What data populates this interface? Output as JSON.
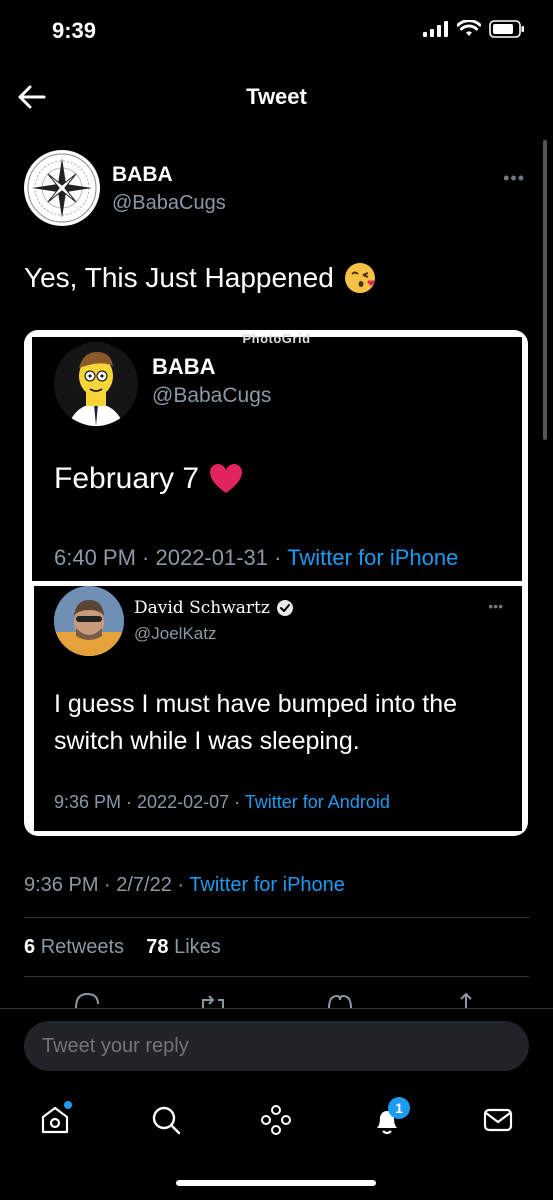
{
  "status_bar": {
    "time": "9:39"
  },
  "header": {
    "title": "Tweet"
  },
  "tweet": {
    "author_name": "BABA",
    "author_handle": "@BabaCugs",
    "more": "•••",
    "text": "Yes, This Just Happened",
    "meta_time": "9:36 PM · 2/7/22 · ",
    "meta_source": "Twitter for iPhone",
    "retweets_count": "6",
    "retweets_label": "Retweets",
    "likes_count": "78",
    "likes_label": "Likes"
  },
  "embedded_image": {
    "watermark": "PhotoGrid",
    "quote1": {
      "author_name": "BABA",
      "author_handle": "@BabaCugs",
      "text": "February 7",
      "meta_time": "6:40 PM · 2022-01-31 · ",
      "meta_source": "Twitter for iPhone"
    },
    "quote2": {
      "author_name": "David Schwartz",
      "author_handle": "@JoelKatz",
      "more": "•••",
      "text": "I guess I must have bumped into the switch while I was sleeping.",
      "meta_time": "9:36 PM · 2022-02-07 · ",
      "meta_source": "Twitter for Android"
    }
  },
  "reply": {
    "placeholder": "Tweet your reply"
  },
  "nav": {
    "notifications_badge": "1"
  },
  "colors": {
    "accent": "#1d9bf0",
    "background": "#000000",
    "secondary_text": "#8b98a5",
    "heart": "#e0245e"
  }
}
